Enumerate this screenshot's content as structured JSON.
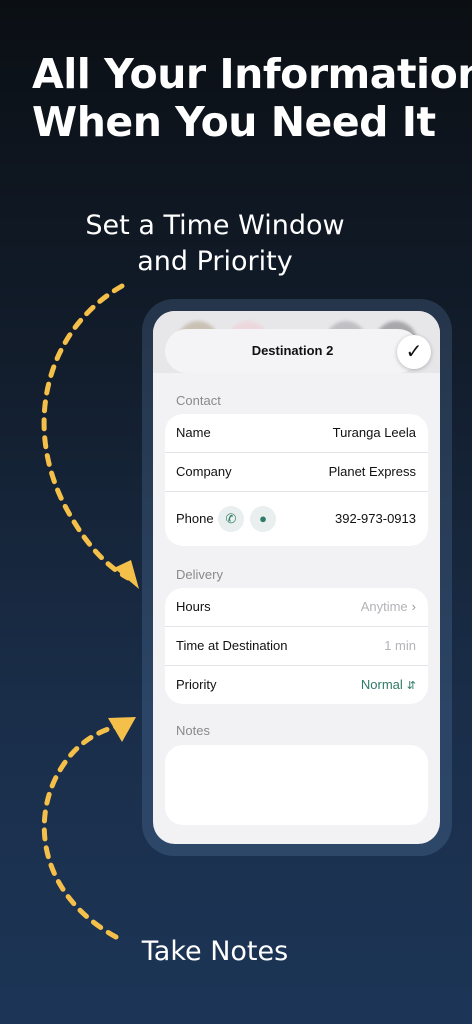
{
  "headline": {
    "line1": "All Your Information",
    "line2": "When You Need It"
  },
  "captions": {
    "top_line1": "Set a Time Window",
    "top_line2": "and Priority",
    "bottom": "Take Notes"
  },
  "colors": {
    "arrow": "#f5c04a",
    "accent": "#2f7a6a",
    "muted": "#8a8a8e"
  },
  "screen": {
    "title": "Destination 2",
    "done_glyph": "✓",
    "contact": {
      "section_label": "Contact",
      "rows": [
        {
          "label": "Name",
          "value": "Turanga Leela"
        },
        {
          "label": "Company",
          "value": "Planet Express"
        },
        {
          "label": "Phone",
          "value": "392-973-0913"
        }
      ],
      "phone_icons": [
        "phone-icon",
        "message-icon"
      ]
    },
    "delivery": {
      "section_label": "Delivery",
      "rows": [
        {
          "label": "Hours",
          "value": "Anytime"
        },
        {
          "label": "Time at Destination",
          "value": "1 min"
        },
        {
          "label": "Priority",
          "value": "Normal"
        }
      ]
    },
    "notes": {
      "section_label": "Notes",
      "value": ""
    }
  }
}
